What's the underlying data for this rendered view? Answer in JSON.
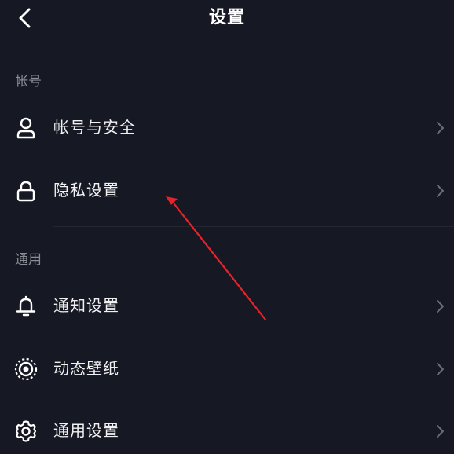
{
  "nav": {
    "title": "设置",
    "back_icon": "chevron-left-icon"
  },
  "sections": [
    {
      "header": "帐号",
      "items": [
        {
          "label": "帐号与安全",
          "icon": "user-icon"
        },
        {
          "label": "隐私设置",
          "icon": "lock-icon"
        }
      ]
    },
    {
      "header": "通用",
      "items": [
        {
          "label": "通知设置",
          "icon": "bell-icon"
        },
        {
          "label": "动态壁纸",
          "icon": "live-wallpaper-icon"
        },
        {
          "label": "通用设置",
          "icon": "gear-icon"
        }
      ]
    }
  ],
  "colors": {
    "background": "#161823",
    "text": "#f1f1f2",
    "section_header": "#8b8d95",
    "chevron": "#6b6d75",
    "annotation_arrow": "#e8222a"
  }
}
